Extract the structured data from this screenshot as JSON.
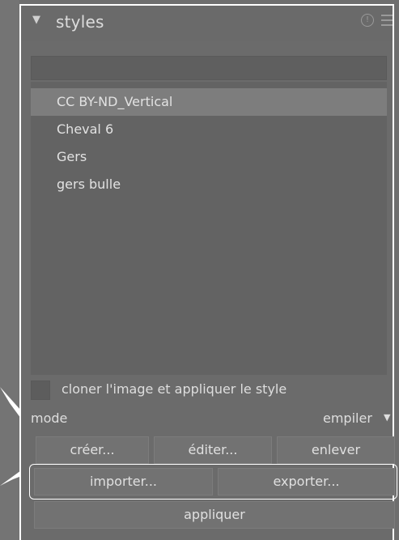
{
  "panel": {
    "title": "styles",
    "search_placeholder": "",
    "styles": [
      {
        "label": "CC BY-ND_Vertical",
        "selected": true
      },
      {
        "label": "Cheval 6",
        "selected": false
      },
      {
        "label": "Gers",
        "selected": false
      },
      {
        "label": "gers bulle",
        "selected": false
      }
    ],
    "duplicate_checkbox_label": "cloner l'image et appliquer le style",
    "duplicate_checked": false,
    "mode_label": "mode",
    "mode_value": "empiler",
    "buttons": {
      "create": "créer...",
      "edit": "éditer...",
      "remove": "enlever",
      "import": "importer...",
      "export": "exporter...",
      "apply": "appliquer"
    }
  },
  "colors": {
    "annotation_outline": "#ffffff",
    "selected_row": "#7d7d7d",
    "panel_bg": "#6b6b6b"
  }
}
